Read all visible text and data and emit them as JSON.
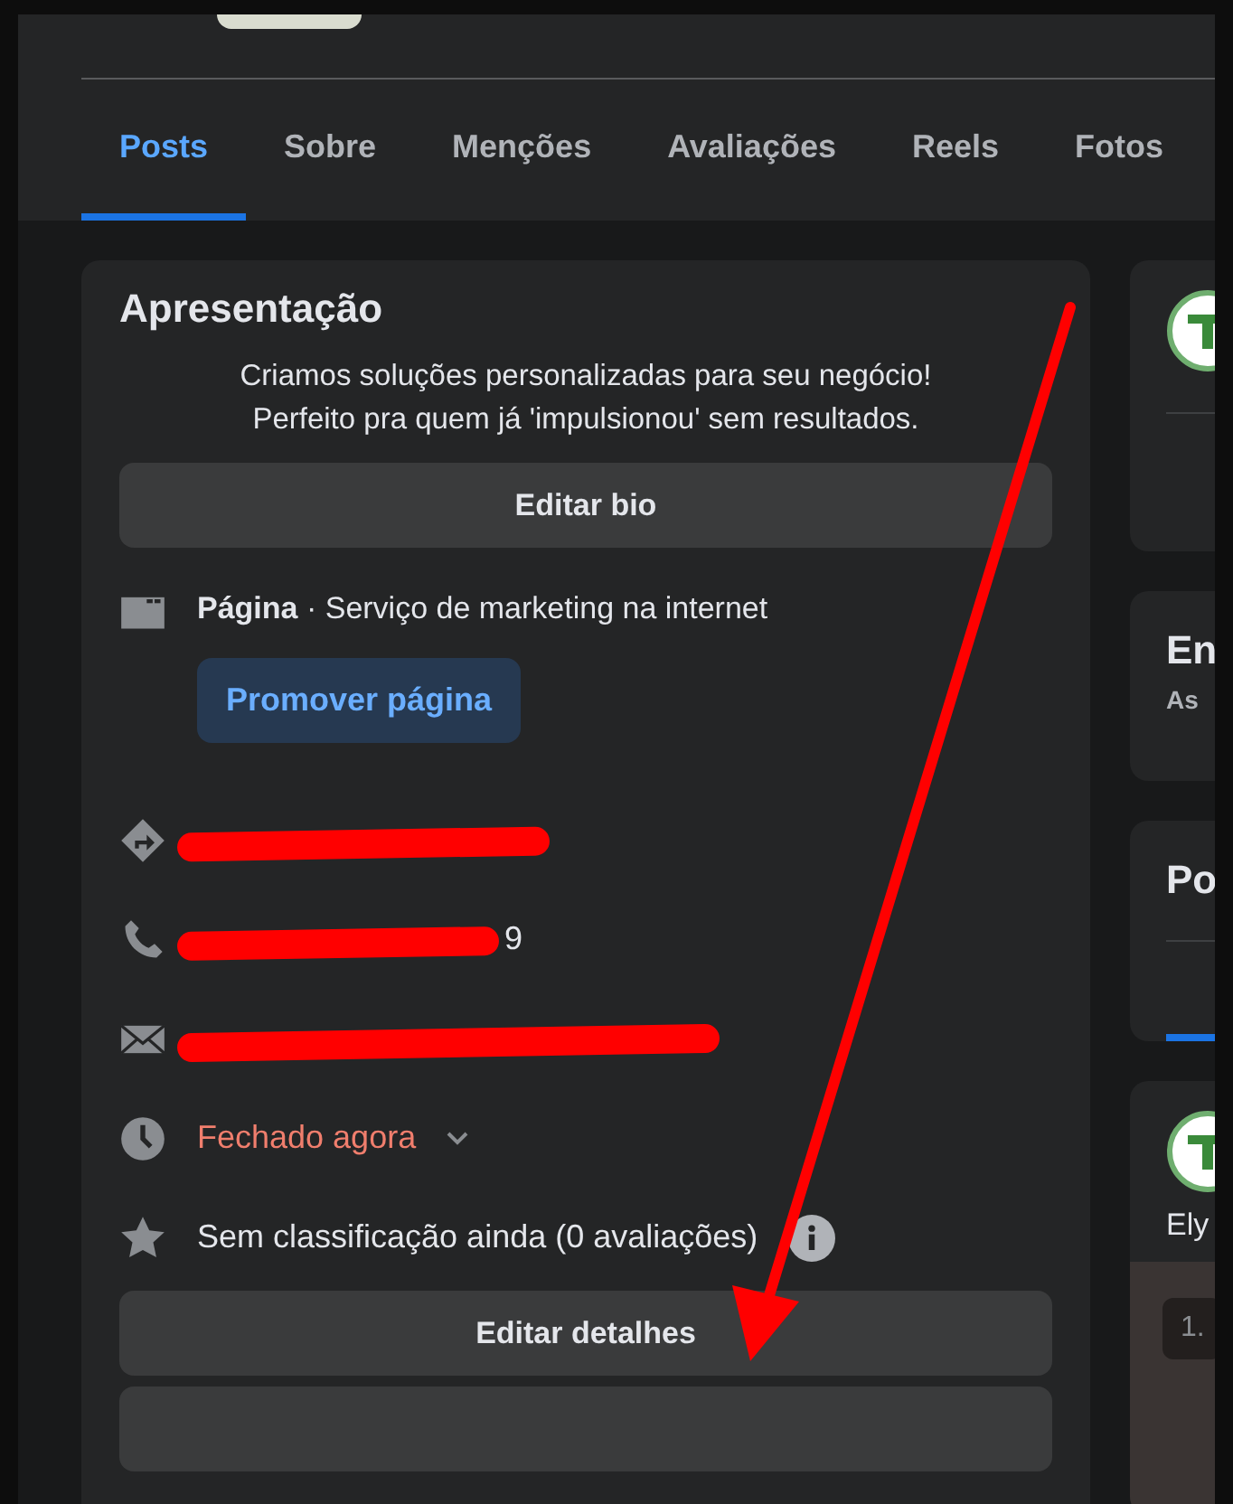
{
  "tabs": [
    {
      "label": "Posts",
      "selected": true
    },
    {
      "label": "Sobre",
      "selected": false
    },
    {
      "label": "Menções",
      "selected": false
    },
    {
      "label": "Avaliações",
      "selected": false
    },
    {
      "label": "Reels",
      "selected": false
    },
    {
      "label": "Fotos",
      "selected": false
    }
  ],
  "intro": {
    "title": "Apresentação",
    "bio_lines": [
      "Criamos soluções personalizadas para seu negócio!",
      "Perfeito pra quem já 'impulsionou' sem resultados."
    ],
    "edit_bio": "Editar bio",
    "category_label": "Página",
    "category": " · Serviço de marketing na internet",
    "promote": "Promover página",
    "details": [
      {
        "kind": "address",
        "redacted": true
      },
      {
        "kind": "phone",
        "redacted": true,
        "text": "9"
      },
      {
        "kind": "email",
        "redacted": true
      },
      {
        "kind": "hours",
        "text": "Fechado agora",
        "expandable": true
      },
      {
        "kind": "rating",
        "text": "Sem classificação ainda (0 avaliações)",
        "info": true
      }
    ],
    "edit_details": "Editar detalhes"
  },
  "side": {
    "card2_title": "En",
    "card2_sub": "As",
    "card3_title": "Po",
    "post_author": "Ely",
    "post_chip": "1."
  },
  "annotation": {
    "arrow": true
  }
}
